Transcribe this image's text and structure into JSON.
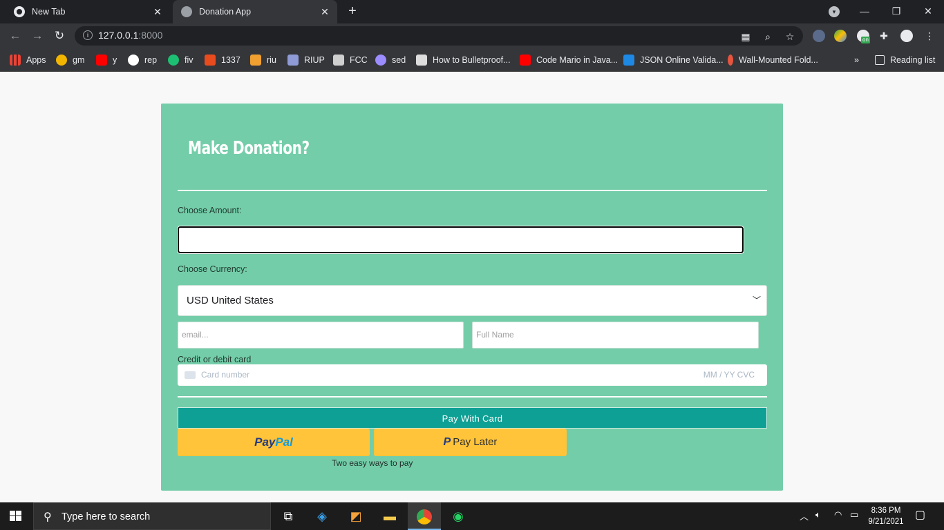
{
  "browser": {
    "tabs": [
      {
        "title": "New Tab"
      },
      {
        "title": "Donation App"
      }
    ],
    "url_host": "127.0.0.1",
    "url_port": ":8000",
    "bookmarks": [
      {
        "label": "Apps",
        "icon": "apps-grid-icon",
        "color": "#ea4335"
      },
      {
        "label": "gm",
        "icon": "gm-icon",
        "color": "#f2b600"
      },
      {
        "label": "y",
        "icon": "youtube-icon",
        "color": "#ff0000"
      },
      {
        "label": "rep",
        "icon": "rep-icon",
        "color": "#ffffff"
      },
      {
        "label": "fiv",
        "icon": "fiverr-icon",
        "color": "#1dbf73"
      },
      {
        "label": "1337",
        "icon": "1337-icon",
        "color": "#e84c1e"
      },
      {
        "label": "riu",
        "icon": "riu-icon",
        "color": "#f0a030"
      },
      {
        "label": "RIUP",
        "icon": "riup-icon",
        "color": "#8e9bd6"
      },
      {
        "label": "FCC",
        "icon": "fcc-icon",
        "color": "#cfcfcf"
      },
      {
        "label": "sed",
        "icon": "sed-icon",
        "color": "#9b8cff"
      },
      {
        "label": "How to Bulletproof...",
        "icon": "avatar-icon",
        "color": "#dddddd"
      },
      {
        "label": "Code Mario in Java...",
        "icon": "youtube-icon",
        "color": "#ff0000"
      },
      {
        "label": "JSON Online Valida...",
        "icon": "json-icon",
        "color": "#1e88e5"
      },
      {
        "label": "Wall-Mounted Fold...",
        "icon": "d-icon",
        "color": "#e8553e"
      }
    ],
    "more_label": "»",
    "reading_list": "Reading list",
    "ext_badge": "on"
  },
  "form": {
    "title": "Make Donation?",
    "amount_label": "Choose Amount:",
    "currency_label": "Choose Currency:",
    "currency_selected": "USD United States",
    "email_placeholder": "email...",
    "name_placeholder": "Full Name",
    "card_label": "Credit or debit card",
    "card_number_placeholder": "Card number",
    "card_exp_placeholder": "MM / YY  CVC",
    "pay_card_label": "Pay With Card",
    "paypal_pay": "Pay",
    "paypal_pal": "Pal",
    "paylater_mark": "P",
    "paylater_label": "Pay Later",
    "tagline": "Two easy ways to pay"
  },
  "taskbar": {
    "search_placeholder": "Type here to search",
    "time": "8:36 PM",
    "date": "9/21/2021"
  },
  "colors": {
    "card_bg": "#74cda9",
    "pay_button": "#0ea094",
    "paypal_yellow": "#ffc439"
  }
}
